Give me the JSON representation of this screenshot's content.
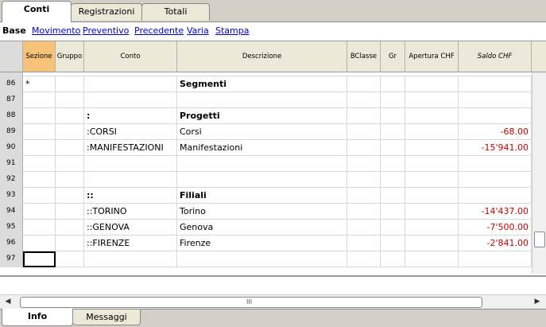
{
  "tabs": [
    {
      "label": "Conti",
      "active": true
    },
    {
      "label": "Registrazioni",
      "active": false
    },
    {
      "label": "Totali",
      "active": false
    }
  ],
  "views": [
    {
      "label": "Base",
      "active": true
    },
    {
      "label": "Movimento",
      "active": false
    },
    {
      "label": "Preventivo",
      "active": false
    },
    {
      "label": "Precedente",
      "active": false
    },
    {
      "label": "Varia",
      "active": false
    },
    {
      "label": "Stampa",
      "active": false
    }
  ],
  "columns": [
    "",
    "Sezione",
    "Gruppo",
    "Conto",
    "Descrizione",
    "BClasse",
    "Gr",
    "Apertura CHF",
    "Saldo CHF"
  ],
  "rows": [
    {
      "n": "86",
      "sezione": "*",
      "gruppo": "",
      "conto": "",
      "descrizione": "Segmenti",
      "bclasse": "",
      "gr": "",
      "apertura": "",
      "saldo": "",
      "bold": true
    },
    {
      "n": "87",
      "sezione": "",
      "gruppo": "",
      "conto": "",
      "descrizione": "",
      "bclasse": "",
      "gr": "",
      "apertura": "",
      "saldo": "",
      "bold": false
    },
    {
      "n": "88",
      "sezione": "",
      "gruppo": "",
      "conto": ":",
      "descrizione": "Progetti",
      "bclasse": "",
      "gr": "",
      "apertura": "",
      "saldo": "",
      "bold": true
    },
    {
      "n": "89",
      "sezione": "",
      "gruppo": "",
      "conto": ":CORSI",
      "descrizione": "Corsi",
      "bclasse": "",
      "gr": "",
      "apertura": "",
      "saldo": "-68.00",
      "bold": false
    },
    {
      "n": "90",
      "sezione": "",
      "gruppo": "",
      "conto": ":MANIFESTAZIONI",
      "descrizione": "Manifestazioni",
      "bclasse": "",
      "gr": "",
      "apertura": "",
      "saldo": "-15'941.00",
      "bold": false
    },
    {
      "n": "91",
      "sezione": "",
      "gruppo": "",
      "conto": "",
      "descrizione": "",
      "bclasse": "",
      "gr": "",
      "apertura": "",
      "saldo": "",
      "bold": false
    },
    {
      "n": "92",
      "sezione": "",
      "gruppo": "",
      "conto": "",
      "descrizione": "",
      "bclasse": "",
      "gr": "",
      "apertura": "",
      "saldo": "",
      "bold": false
    },
    {
      "n": "93",
      "sezione": "",
      "gruppo": "",
      "conto": "::",
      "descrizione": "Filiali",
      "bclasse": "",
      "gr": "",
      "apertura": "",
      "saldo": "",
      "bold": true
    },
    {
      "n": "94",
      "sezione": "",
      "gruppo": "",
      "conto": "::TORINO",
      "descrizione": "Torino",
      "bclasse": "",
      "gr": "",
      "apertura": "",
      "saldo": "-14'437.00",
      "bold": false
    },
    {
      "n": "95",
      "sezione": "",
      "gruppo": "",
      "conto": "::GENOVA",
      "descrizione": "Genova",
      "bclasse": "",
      "gr": "",
      "apertura": "",
      "saldo": "-7'500.00",
      "bold": false
    },
    {
      "n": "96",
      "sezione": "",
      "gruppo": "",
      "conto": "::FIRENZE",
      "descrizione": "Firenze",
      "bclasse": "",
      "gr": "",
      "apertura": "",
      "saldo": "-2'841.00",
      "bold": false
    },
    {
      "n": "97",
      "sezione": "",
      "gruppo": "",
      "conto": "",
      "descrizione": "",
      "bclasse": "",
      "gr": "",
      "apertura": "",
      "saldo": "",
      "bold": false
    }
  ],
  "scrollbar": {
    "grip": "III"
  },
  "bottom_tabs": [
    {
      "label": "Info",
      "active": true
    },
    {
      "label": "Messaggi",
      "active": false
    }
  ],
  "colors": {
    "negative": "#cc0000",
    "selected_header": "#f7c27a",
    "link": "#0000cc"
  }
}
